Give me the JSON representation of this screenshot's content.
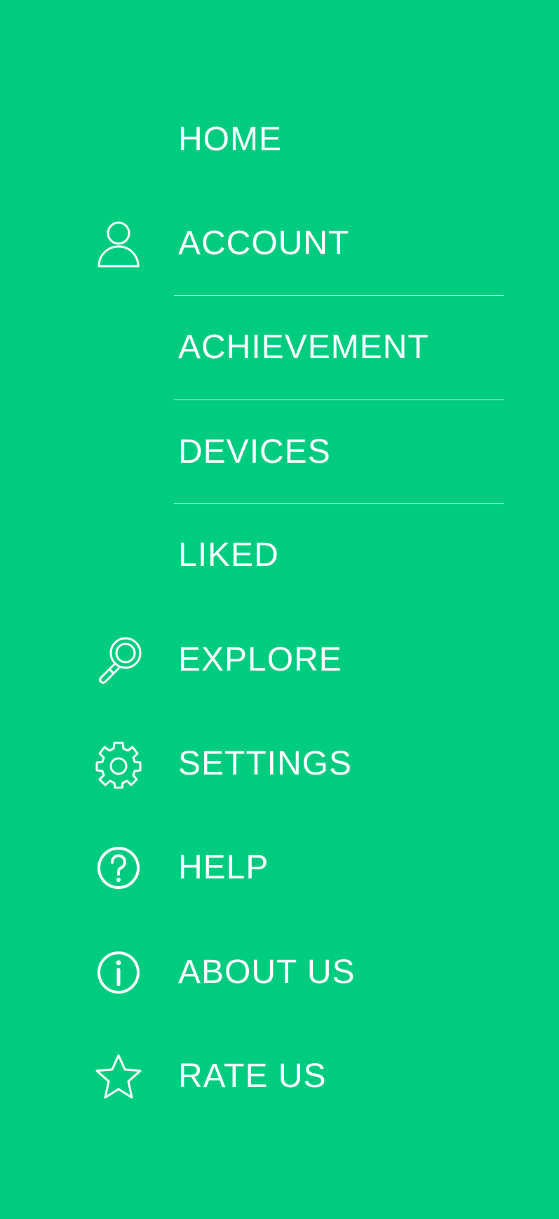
{
  "theme": {
    "background": "#00CC80",
    "foreground": "#FFFFFF"
  },
  "menu": {
    "items": [
      {
        "label": "HOME",
        "icon": null
      },
      {
        "label": "ACCOUNT",
        "icon": "person-icon"
      },
      {
        "label": "ACHIEVEMENT",
        "icon": null
      },
      {
        "label": "DEVICES",
        "icon": null
      },
      {
        "label": "LIKED",
        "icon": null
      },
      {
        "label": "EXPLORE",
        "icon": "magnifier-icon"
      },
      {
        "label": "SETTINGS",
        "icon": "gear-icon"
      },
      {
        "label": "HELP",
        "icon": "question-circle-icon"
      },
      {
        "label": "ABOUT US",
        "icon": "info-circle-icon"
      },
      {
        "label": "RATE US",
        "icon": "star-icon"
      }
    ]
  }
}
